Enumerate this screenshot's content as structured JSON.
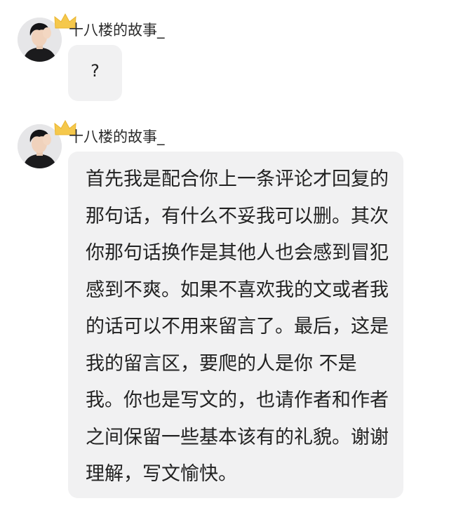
{
  "messages": [
    {
      "username": "十八楼的故事_",
      "avatar_icon": "user-avatar-photo",
      "badge_icon": "crown-icon",
      "text": "?"
    },
    {
      "username": "十八楼的故事_",
      "avatar_icon": "user-avatar-photo",
      "badge_icon": "crown-icon",
      "text": "首先我是配合你上一条评论才回复的那句话，有什么不妥我可以删。其次你那句话换作是其他人也会感到冒犯感到不爽。如果不喜欢我的文或者我的话可以不用来留言了。最后，这是我的留言区，要爬的人是你 不是我。你也是写文的，也请作者和作者之间保留一些基本该有的礼貌。谢谢理解，写文愉快。"
    }
  ],
  "colors": {
    "background": "#ffffff",
    "bubble": "#f1f1f2",
    "text": "#222222",
    "crown": "#f5c84c"
  }
}
